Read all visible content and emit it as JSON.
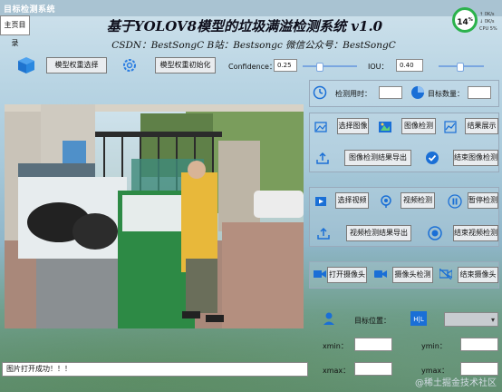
{
  "window": {
    "title": "目标检测系统"
  },
  "menu": {
    "tab_label": "主页目录"
  },
  "header": {
    "title": "基于YOLOV8模型的垃圾满溢检测系统 v1.0",
    "subtitle": "CSDN：BestSongC   B站：Bestsongc   微信公众号：BestSongC"
  },
  "perf": {
    "percent": "14",
    "unit": "%",
    "line1": "↑ 0K/s",
    "line2": "↓ 0K/s",
    "line3": "CPU 5%"
  },
  "model": {
    "select_label": "模型权重选择",
    "init_label": "模型权重初始化",
    "confidence_label": "Confidence：",
    "confidence_value": "0.25",
    "confidence_level": 0.25,
    "iou_label": "IOU：",
    "iou_value": "0.40",
    "iou_level": 0.4
  },
  "stats": {
    "time_label": "检测用时：",
    "time_value": "",
    "count_label": "目标数量：",
    "count_value": ""
  },
  "image": {
    "select_label": "选择图像",
    "detect_label": "图像检测",
    "show_label": "结果展示",
    "export_label": "图像检测结果导出",
    "end_label": "结束图像检测"
  },
  "video": {
    "select_label": "选择视频",
    "detect_label": "视频检测",
    "pause_label": "暂停检测",
    "export_label": "视频检测结果导出",
    "end_label": "结束视频检测"
  },
  "camera": {
    "open_label": "打开摄像头",
    "detect_label": "摄像头检测",
    "end_label": "结束摄像头"
  },
  "target": {
    "position_label": "目标位置：",
    "selected": "",
    "xmin_label": "xmin：",
    "ymin_label": "ymin：",
    "xmax_label": "xmax：",
    "ymax_label": "ymax：",
    "xmin": "",
    "ymin": "",
    "xmax": "",
    "ymax": ""
  },
  "status": {
    "message": "图片打开成功！！！"
  },
  "watermark": "@稀土掘金技术社区",
  "colors": {
    "accent": "#1a6fd6",
    "icon_blue": "#2a7de1",
    "perf_green": "#2bb24c"
  }
}
